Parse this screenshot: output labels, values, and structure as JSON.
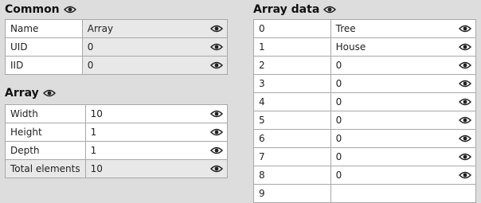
{
  "common": {
    "title": "Common",
    "rows": [
      {
        "key": "Name",
        "value": "Array"
      },
      {
        "key": "UID",
        "value": "0"
      },
      {
        "key": "IID",
        "value": "0"
      }
    ]
  },
  "array": {
    "title": "Array",
    "rows": [
      {
        "key": "Width",
        "value": "10"
      },
      {
        "key": "Height",
        "value": "1"
      },
      {
        "key": "Depth",
        "value": "1"
      },
      {
        "key": "Total elements",
        "value": "10"
      }
    ]
  },
  "array_data": {
    "title": "Array data",
    "rows": [
      {
        "key": "0",
        "value": "Tree"
      },
      {
        "key": "1",
        "value": "House"
      },
      {
        "key": "2",
        "value": "0"
      },
      {
        "key": "3",
        "value": "0"
      },
      {
        "key": "4",
        "value": "0"
      },
      {
        "key": "5",
        "value": "0"
      },
      {
        "key": "6",
        "value": "0"
      },
      {
        "key": "7",
        "value": "0"
      },
      {
        "key": "8",
        "value": "0"
      },
      {
        "key": "9",
        "value": ""
      }
    ]
  },
  "icons": {
    "eye": "eye-icon"
  }
}
